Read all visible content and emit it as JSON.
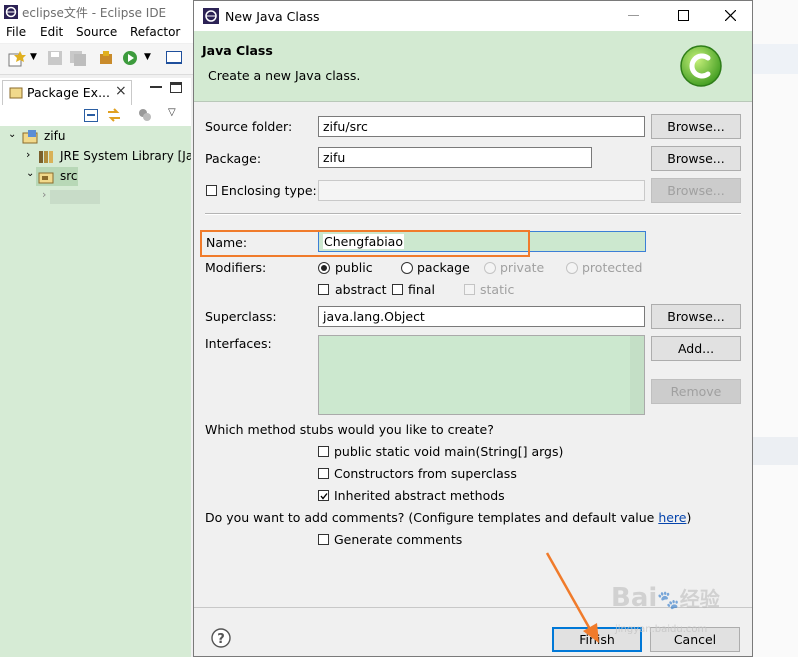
{
  "eclipse": {
    "window_title": "eclipse文件 - Eclipse IDE",
    "menu": [
      "File",
      "Edit",
      "Source",
      "Refactor"
    ],
    "package_explorer": {
      "tab_label": "Package Ex...",
      "tree": [
        {
          "label": "zifu"
        },
        {
          "label": "JRE System Library [Ja"
        },
        {
          "label": "src"
        }
      ]
    }
  },
  "dialog": {
    "title": "New Java Class",
    "banner_title": "Java Class",
    "banner_message": "Create a new Java class.",
    "source_folder": {
      "label": "Source folder:",
      "value": "zifu/src",
      "button": "Browse..."
    },
    "package": {
      "label": "Package:",
      "value": "zifu",
      "button": "Browse..."
    },
    "enclosing_type": {
      "label": "Enclosing type:",
      "value": "",
      "button": "Browse...",
      "checked": false
    },
    "name": {
      "label": "Name:",
      "value": "Chengfabiao"
    },
    "modifiers": {
      "label": "Modifiers:",
      "access": [
        {
          "label": "public",
          "selected": true,
          "enabled": true
        },
        {
          "label": "package",
          "selected": false,
          "enabled": true
        },
        {
          "label": "private",
          "selected": false,
          "enabled": false
        },
        {
          "label": "protected",
          "selected": false,
          "enabled": false
        }
      ],
      "other": [
        {
          "label": "abstract",
          "checked": false,
          "enabled": true
        },
        {
          "label": "final",
          "checked": false,
          "enabled": true
        },
        {
          "label": "static",
          "checked": false,
          "enabled": false
        }
      ]
    },
    "superclass": {
      "label": "Superclass:",
      "value": "java.lang.Object",
      "button": "Browse..."
    },
    "interfaces": {
      "label": "Interfaces:",
      "add_button": "Add...",
      "remove_button": "Remove"
    },
    "stubs": {
      "question": "Which method stubs would you like to create?",
      "options": [
        {
          "label": "public static void main(String[] args)",
          "checked": false
        },
        {
          "label": "Constructors from superclass",
          "checked": false
        },
        {
          "label": "Inherited abstract methods",
          "checked": true
        }
      ]
    },
    "comments": {
      "question": "Do you want to add comments? (Configure templates and default value ",
      "link": "here",
      "question_end": ")",
      "option": {
        "label": "Generate comments",
        "checked": false
      }
    },
    "footer": {
      "finish": "Finish",
      "cancel": "Cancel"
    }
  },
  "watermark": {
    "brand": "Bai",
    "brand2": "经验",
    "url": "jingyan.baidu.com"
  },
  "colors": {
    "banner": "#d3ead2",
    "highlight": "#f07b2b",
    "name_field": "#cce8cf"
  }
}
